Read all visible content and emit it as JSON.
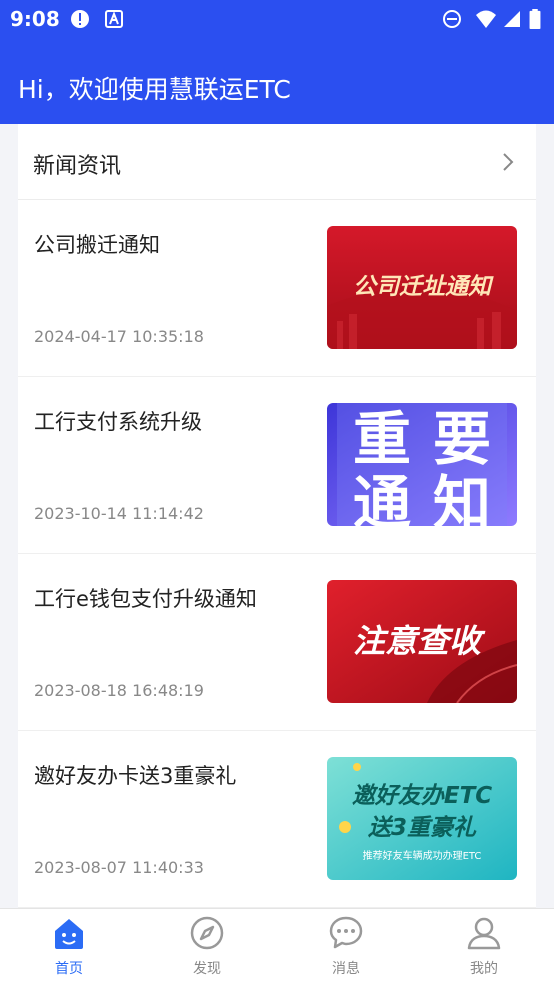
{
  "status_bar": {
    "time": "9:08"
  },
  "header": {
    "welcome": "Hi，欢迎使用慧联运ETC"
  },
  "news": {
    "section_title": "新闻资讯",
    "items": [
      {
        "title": "公司搬迁通知",
        "date": "2024-04-17 10:35:18",
        "image_text": "公司迁址通知"
      },
      {
        "title": "工行支付系统升级",
        "date": "2023-10-14 11:14:42",
        "image_text": [
          "重",
          "要",
          "通",
          "知"
        ]
      },
      {
        "title": "工行e钱包支付升级通知",
        "date": "2023-08-18 16:48:19",
        "image_text": "注意查收"
      },
      {
        "title": "邀好友办卡送3重豪礼",
        "date": "2023-08-07 11:40:33",
        "image_text": [
          "邀好友办ETC",
          "送3重豪礼",
          "推荐好友车辆成功办理ETC"
        ]
      }
    ]
  },
  "tabbar": {
    "tabs": [
      {
        "label": "首页",
        "icon": "home-icon",
        "active": true
      },
      {
        "label": "发现",
        "icon": "compass-icon",
        "active": false
      },
      {
        "label": "消息",
        "icon": "chat-bubble-icon",
        "active": false
      },
      {
        "label": "我的",
        "icon": "user-icon",
        "active": false
      }
    ]
  },
  "colors": {
    "header_blue": "#2b4ff0",
    "active_tab": "#2b6cf5",
    "text_primary": "#222222",
    "text_secondary": "#888888"
  }
}
